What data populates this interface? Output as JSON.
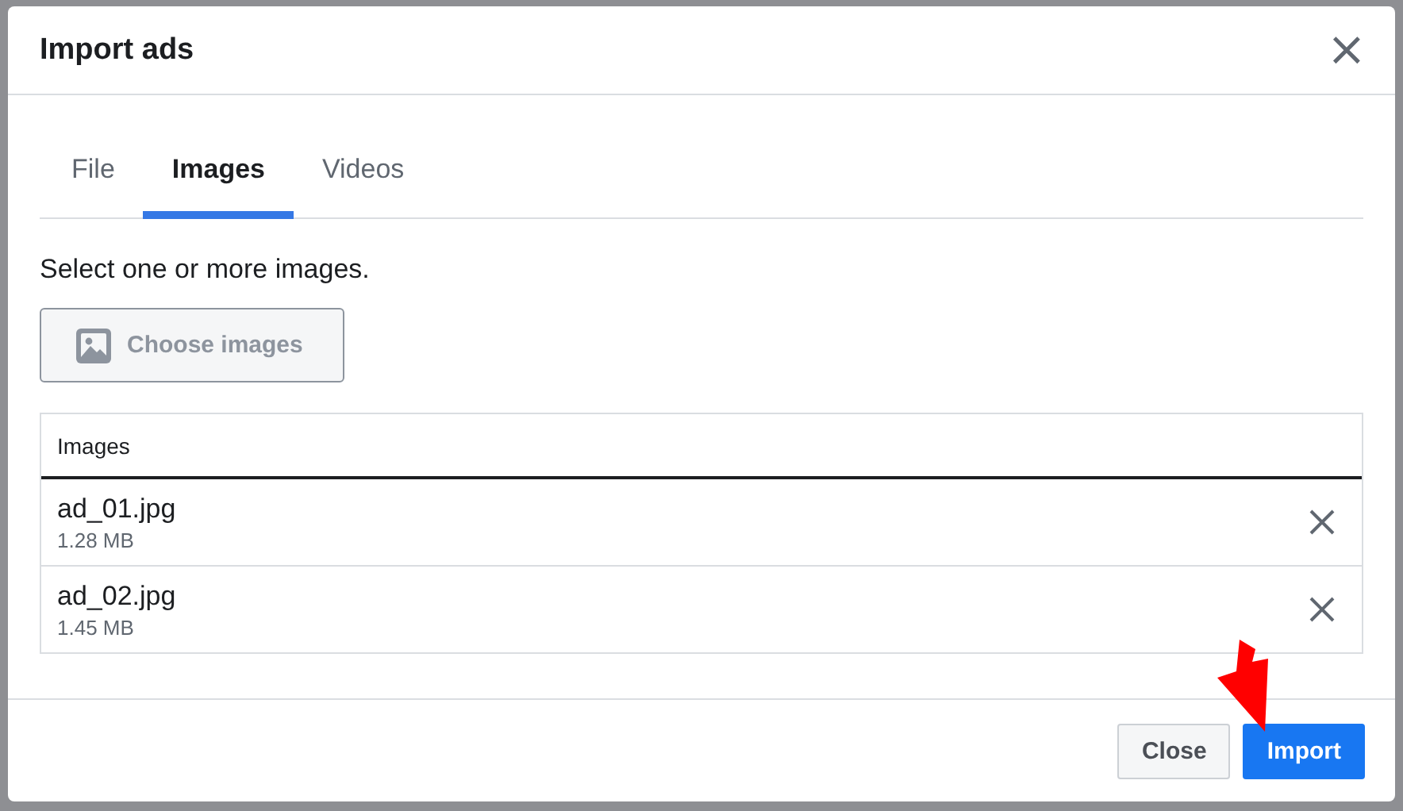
{
  "dialog": {
    "title": "Import ads",
    "close_label": "×"
  },
  "tabs": [
    {
      "label": "File",
      "selected": false
    },
    {
      "label": "Images",
      "selected": true
    },
    {
      "label": "Videos",
      "selected": false
    }
  ],
  "instruction": "Select one or more images.",
  "choose_button": {
    "label": "Choose images",
    "disabled": true
  },
  "table": {
    "columns": [
      "Images"
    ],
    "rows": [
      {
        "name": "ad_01.jpg",
        "size": "1.28 MB"
      },
      {
        "name": "ad_02.jpg",
        "size": "1.45 MB"
      }
    ]
  },
  "buttons": [
    {
      "label": "Close",
      "kind": "secondary"
    },
    {
      "label": "Import",
      "kind": "primary"
    }
  ],
  "annotation": {
    "kind": "arrow"
  }
}
